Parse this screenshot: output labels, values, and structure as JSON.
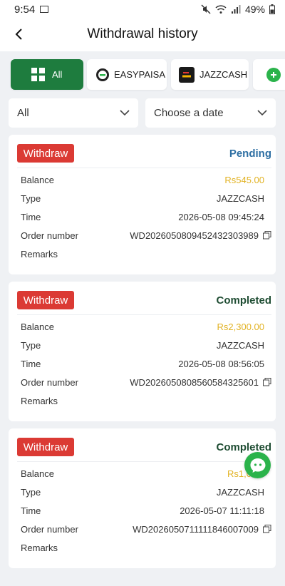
{
  "status_bar": {
    "time": "9:54",
    "battery": "49%"
  },
  "header": {
    "title": "Withdrawal history"
  },
  "tabs": [
    {
      "label": "All",
      "active": true
    },
    {
      "label": "EASYPAISA",
      "active": false
    },
    {
      "label": "JAZZCASH",
      "active": false
    }
  ],
  "filters": {
    "type_value": "All",
    "date_placeholder": "Choose a date"
  },
  "labels": {
    "balance": "Balance",
    "type": "Type",
    "time": "Time",
    "order_number": "Order number",
    "remarks": "Remarks"
  },
  "records": [
    {
      "badge": "Withdraw",
      "status": "Pending",
      "status_color": "#2e6fa3",
      "balance": "Rs545.00",
      "type": "JAZZCASH",
      "time": "2026-05-08 09:45:24",
      "order_number": "WD2026050809452432303989",
      "remarks": ""
    },
    {
      "badge": "Withdraw",
      "status": "Completed",
      "status_color": "#1f4d33",
      "balance": "Rs2,300.00",
      "type": "JAZZCASH",
      "time": "2026-05-08 08:56:05",
      "order_number": "WD2026050808560584325601",
      "remarks": ""
    },
    {
      "badge": "Withdraw",
      "status": "Completed",
      "status_color": "#1f4d33",
      "balance": "Rs1,0",
      "type": "JAZZCASH",
      "time": "2026-05-07 11:11:18",
      "order_number": "WD2026050711111846007009",
      "remarks": ""
    }
  ],
  "colors": {
    "accent": "#1e7c3e",
    "badge": "#db3a34",
    "money": "#e2b325"
  }
}
